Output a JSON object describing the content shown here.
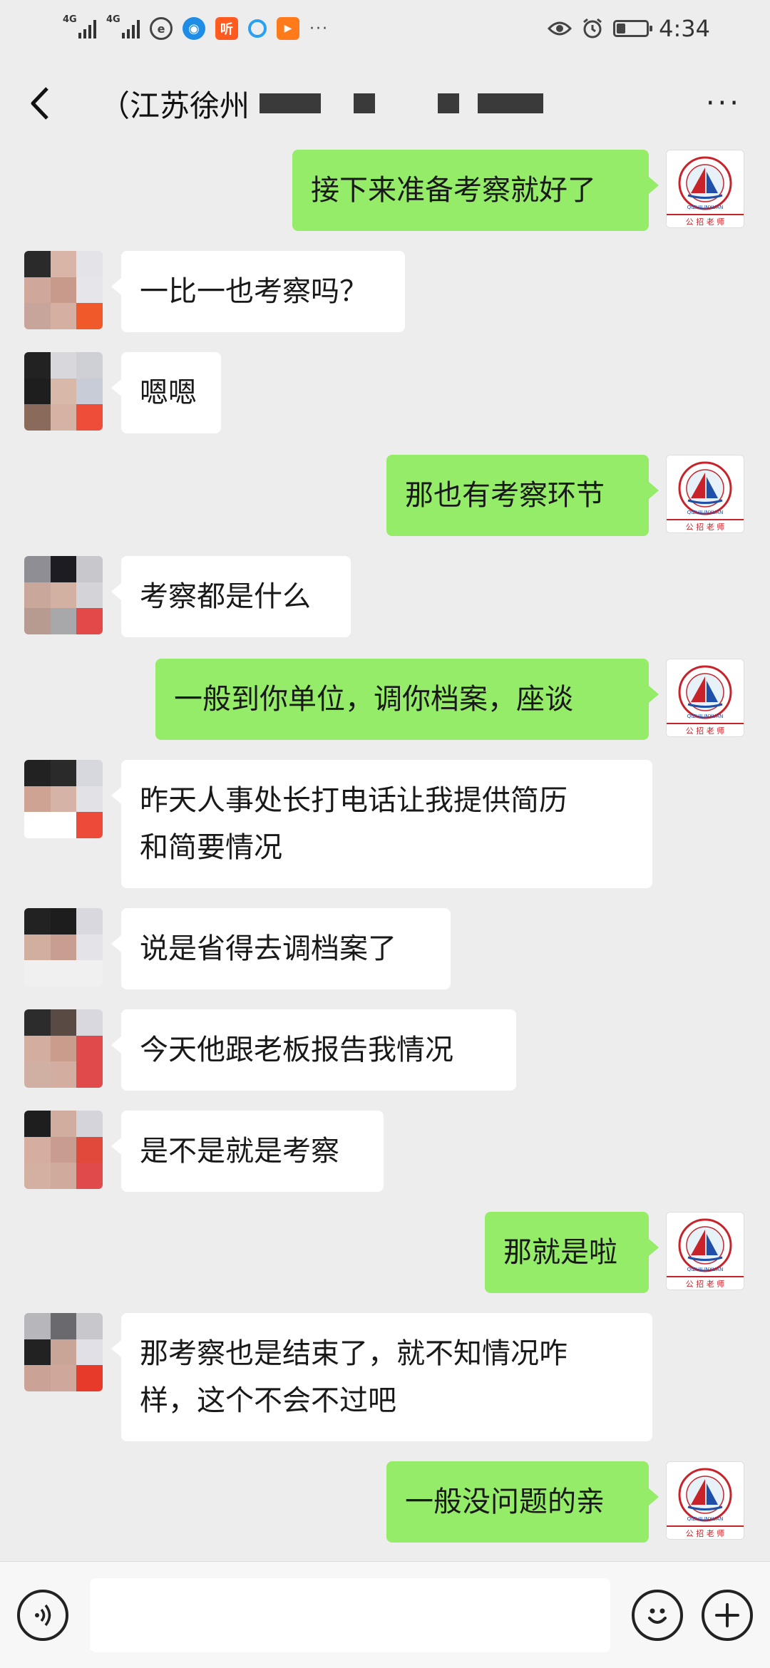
{
  "status_bar": {
    "network_1": "4G",
    "network_2": "4G",
    "app_icon_ting": "听",
    "overflow": "···",
    "time": "4:34",
    "battery_level": 0.3
  },
  "nav": {
    "title": "（江苏徐州",
    "more": "···"
  },
  "messages": [
    {
      "side": "sent",
      "text": "接下来准备考察就好了"
    },
    {
      "side": "recv",
      "text": "一比一也考察吗？"
    },
    {
      "side": "recv",
      "text": "嗯嗯"
    },
    {
      "side": "sent",
      "text": "那也有考察环节"
    },
    {
      "side": "recv",
      "text": "考察都是什么"
    },
    {
      "side": "sent",
      "text": "一般到你单位，调你档案，座谈"
    },
    {
      "side": "recv",
      "text": "昨天人事处长打电话让我提供简历\n和简要情况"
    },
    {
      "side": "recv",
      "text": "说是省得去调档案了"
    },
    {
      "side": "recv",
      "text": "今天他跟老板报告我情况"
    },
    {
      "side": "recv",
      "text": "是不是就是考察"
    },
    {
      "side": "sent",
      "text": "那就是啦"
    },
    {
      "side": "recv",
      "text": "那考察也是结束了，就不知情况咋\n样，这个不会不过吧"
    },
    {
      "side": "sent",
      "text": "一般没问题的亲"
    }
  ],
  "sender_avatar": {
    "logo_text": "QIZHILINXUAN",
    "caption": "公 招 老 师"
  },
  "colors": {
    "sent_bubble": "#95ec69",
    "recv_bubble": "#ffffff",
    "background": "#ededed"
  },
  "input_bar": {
    "placeholder": ""
  }
}
